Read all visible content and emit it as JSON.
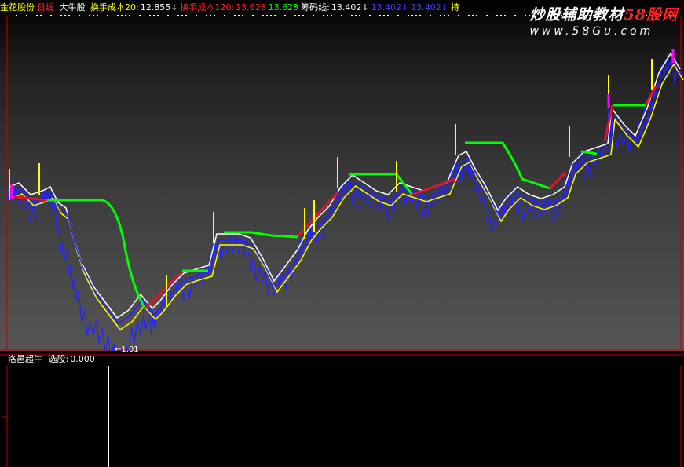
{
  "header": {
    "stock_name": "金花股份",
    "period": "日线",
    "indicator_name": "大牛股",
    "items": [
      {
        "label": "换手成本20:",
        "value": "12.855↓",
        "label_color": "#ffff00",
        "value_color": "#ffffff"
      },
      {
        "label": "换手成本120:",
        "value": "13.628",
        "label_color": "#ff2020",
        "value_color": "#ff2020"
      },
      {
        "label": "",
        "value": "13.628",
        "label_color": "#00ff00",
        "value_color": "#00ff00"
      },
      {
        "label": "筹码线:",
        "value": "13.402↓",
        "label_color": "#ffffff",
        "value_color": "#ffffff"
      },
      {
        "label": "",
        "value": "13.402↓",
        "label_color": "#4040ff",
        "value_color": "#4040ff"
      },
      {
        "label": "",
        "value": "13.402↓",
        "label_color": "#4040ff",
        "value_color": "#4040ff"
      },
      {
        "label": "持",
        "value": "",
        "label_color": "#ffff00",
        "value_color": "#ffff00"
      }
    ]
  },
  "watermark": {
    "title_part1": "炒股辅助教材",
    "title_part2": "58股网",
    "url": "www.58Gu.com"
  },
  "main_chart": {
    "min_price_label": "←1.01",
    "colors": {
      "blue": "#2424ff",
      "white": "#ffffff",
      "yellow": "#ffff00",
      "green": "#00ff00",
      "red": "#e0142e",
      "magenta": "#ff00ff"
    }
  },
  "sub_panel": {
    "indicator_name": "洛邑超牛",
    "select_label": "选股:",
    "select_value": "0.000"
  },
  "chart_data": {
    "type": "line",
    "title": "",
    "series": [
      {
        "name": "换手成本20",
        "color": "#ffff00"
      },
      {
        "name": "换手成本120",
        "color": "#ff2020"
      },
      {
        "name": "筹码线",
        "color": "#ffffff"
      }
    ],
    "sub_signal": {
      "name": "选股",
      "current_value": 0.0,
      "signal_count": 1
    }
  }
}
